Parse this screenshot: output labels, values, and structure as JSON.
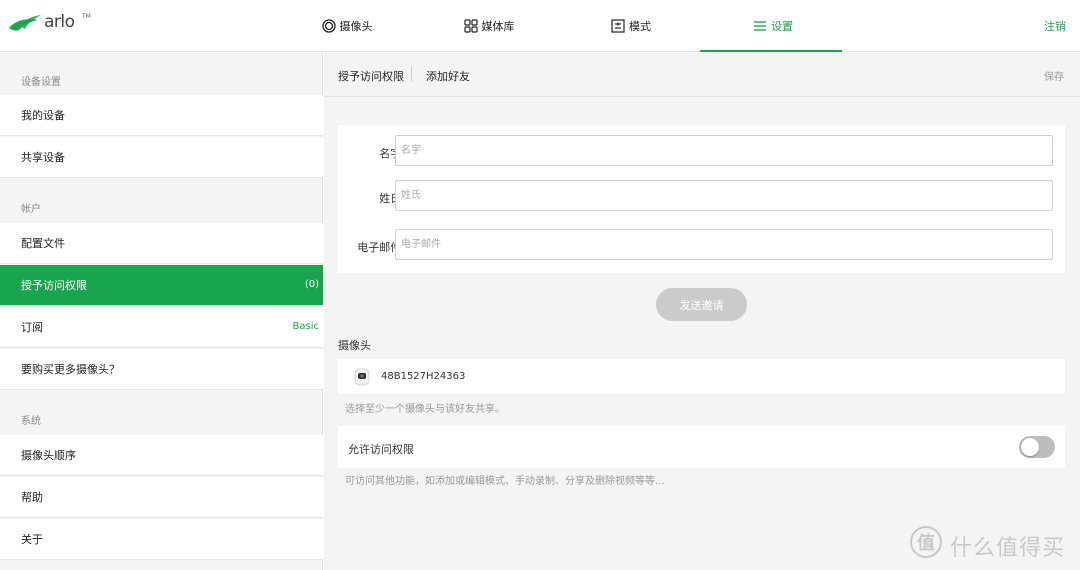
{
  "brand": {
    "name": "arlo",
    "mark": "TM",
    "color": "#19a54d"
  },
  "topnav": {
    "items": [
      {
        "label": "摄像头",
        "icon": "camera-icon"
      },
      {
        "label": "媒体库",
        "icon": "library-grid-icon"
      },
      {
        "label": "模式",
        "icon": "mode-icon"
      },
      {
        "label": "设置",
        "icon": "menu-icon",
        "active": true
      }
    ],
    "logout": "注销"
  },
  "sidebar": {
    "sections": [
      {
        "heading": "设备设置",
        "items": [
          {
            "label": "我的设备"
          },
          {
            "label": "共享设备"
          }
        ]
      },
      {
        "heading": "帐户",
        "items": [
          {
            "label": "配置文件"
          },
          {
            "label": "授予访问权限",
            "badge": "(0)",
            "active": true
          },
          {
            "label": "订阅",
            "value": "Basic"
          },
          {
            "label": "要购买更多摄像头？"
          }
        ]
      },
      {
        "heading": "系统",
        "items": [
          {
            "label": "摄像头顺序"
          },
          {
            "label": "帮助"
          },
          {
            "label": "关于"
          }
        ]
      }
    ]
  },
  "main": {
    "tabs": [
      {
        "label": "授予访问权限"
      },
      {
        "label": "添加好友"
      }
    ],
    "save_label": "保存",
    "form": {
      "first_name": {
        "label": "名字:",
        "placeholder": "名字",
        "value": ""
      },
      "last_name": {
        "label": "姓氏:",
        "placeholder": "姓氏",
        "value": ""
      },
      "email": {
        "label": "电子邮件:",
        "placeholder": "电子邮件",
        "value": ""
      }
    },
    "invite_button": "发送邀请",
    "cameras": {
      "heading": "摄像头",
      "items": [
        {
          "id": "48B1527H24363"
        }
      ],
      "hint": "选择至少一个摄像头与该好友共享。"
    },
    "permission": {
      "label": "允许访问权限",
      "enabled": false,
      "hint": "可访问其他功能，如添加或编辑模式、手动录制、分享及删除视频等等..."
    }
  },
  "watermark": {
    "symbol": "值",
    "text": "什么值得买"
  }
}
